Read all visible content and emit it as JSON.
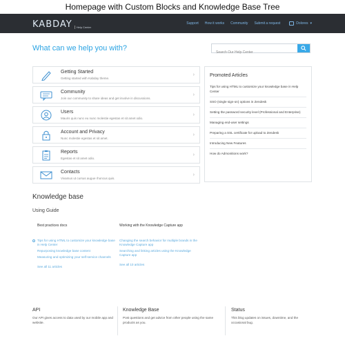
{
  "caption": "Homepage with Custom Blocks and Knowledge Base Tree",
  "header": {
    "logo_word": "KABDAY",
    "logo_sub": "Help Center",
    "nav": [
      "Support",
      "How it works",
      "Community",
      "Submit a request"
    ],
    "user_label": "Dolores"
  },
  "hero": {
    "title": "What can we help you with?",
    "search_placeholder": "Search Our Help Center"
  },
  "categories": [
    {
      "title": "Getting Started",
      "desc": "Getting started with Kabday theme.",
      "icon": "pencil-icon"
    },
    {
      "title": "Community",
      "desc": "Join our community to share ideas and get involve in discussions.",
      "icon": "chat-icon"
    },
    {
      "title": "Users",
      "desc": "Mauris quis nunc eu nunc molestie egestas et sit amet odio.",
      "icon": "user-icon"
    },
    {
      "title": "Account and Privacy",
      "desc": "Nunc molestie egestas et sit amet.",
      "icon": "lock-icon"
    },
    {
      "title": "Reports",
      "desc": "Egestas et sit amet odio.",
      "icon": "clipboard-icon"
    },
    {
      "title": "Contacts",
      "desc": "Vivamus ut cursus augue rhoncus quis.",
      "icon": "envelope-icon"
    }
  ],
  "promoted": {
    "title": "Promoted Articles",
    "items": [
      "Tips for using HTML to customize your knowledge base in Help Center",
      "SSO (single sign-on) options in Zendesk",
      "Setting the password security level (Professional and Enterprise)",
      "Managing end-user settings",
      "Preparing a SSL certificate for upload to Zendesk",
      "Introducing New Features",
      "How do Admonitions work?"
    ]
  },
  "knowledge_base": {
    "title": "Knowledge base",
    "section_title": "Using Guide",
    "columns": [
      {
        "title": "Best practices docs",
        "links": [
          "Tips for using HTML to customize your knowledge base in Help Center",
          "Repurposing knowledge base content",
          "Measuring and optimizing your self-service channels"
        ],
        "see_all": "See all 11 articles"
      },
      {
        "title": "Working with the Knowledge Capture app",
        "links": [
          "Changing the search behavior for multiple brands in the Knowledge Capture app",
          "Searching and linking articles using the Knowledge Capture app"
        ],
        "see_all": "See all 10 articles"
      }
    ]
  },
  "footer": [
    {
      "title": "API",
      "text": "Our API gives access to data used by our mobile app and website."
    },
    {
      "title": "Knowledge Base",
      "text": "Post questions and get advice from other people using the same products as you."
    },
    {
      "title": "Status",
      "text": "This blog updates on issues, downtime, and the occasional bug."
    }
  ]
}
